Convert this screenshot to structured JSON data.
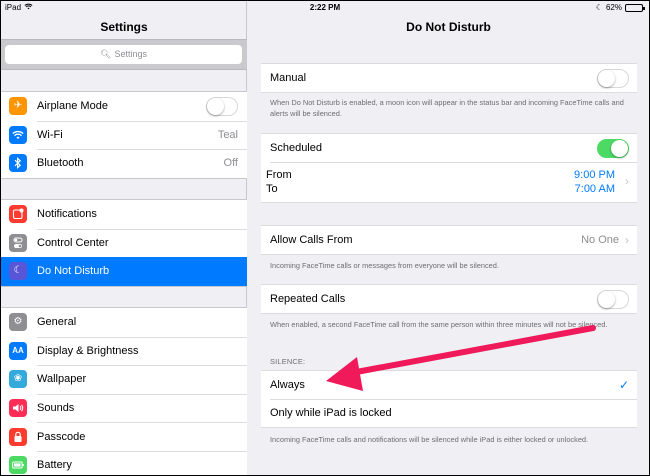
{
  "status": {
    "device": "iPad",
    "time": "2:22 PM",
    "battery": "62%",
    "battery_level": 0.62
  },
  "left": {
    "title": "Settings",
    "search_placeholder": "Settings",
    "groups": [
      [
        {
          "label": "Airplane Mode",
          "icon": "airplane-icon",
          "color": "#ff9500",
          "value": "",
          "toggle": false
        },
        {
          "label": "Wi-Fi",
          "icon": "wifi-icon",
          "color": "#007aff",
          "value": "Teal"
        },
        {
          "label": "Bluetooth",
          "icon": "bluetooth-icon",
          "color": "#007aff",
          "value": "Off"
        }
      ],
      [
        {
          "label": "Notifications",
          "icon": "notifications-icon",
          "color": "#ff3b30"
        },
        {
          "label": "Control Center",
          "icon": "control-center-icon",
          "color": "#8e8e93"
        },
        {
          "label": "Do Not Disturb",
          "icon": "moon-icon",
          "color": "#5856d6",
          "selected": true
        }
      ],
      [
        {
          "label": "General",
          "icon": "gear-icon",
          "color": "#8e8e93"
        },
        {
          "label": "Display & Brightness",
          "icon": "display-icon",
          "color": "#007aff"
        },
        {
          "label": "Wallpaper",
          "icon": "wallpaper-icon",
          "color": "#34aadc"
        },
        {
          "label": "Sounds",
          "icon": "sounds-icon",
          "color": "#ff2d55"
        },
        {
          "label": "Passcode",
          "icon": "lock-icon",
          "color": "#ff3b30"
        },
        {
          "label": "Battery",
          "icon": "battery-icon",
          "color": "#4cd964"
        }
      ]
    ]
  },
  "right": {
    "title": "Do Not Disturb",
    "manual": {
      "label": "Manual",
      "on": false,
      "note": "When Do Not Disturb is enabled, a moon icon will appear in the status bar and incoming FaceTime calls and alerts will be silenced."
    },
    "scheduled": {
      "label": "Scheduled",
      "on": true,
      "from_label": "From",
      "to_label": "To",
      "from": "9:00 PM",
      "to": "7:00 AM"
    },
    "allow_calls": {
      "label": "Allow Calls From",
      "value": "No One",
      "note": "Incoming FaceTime calls or messages from everyone will be silenced."
    },
    "repeated": {
      "label": "Repeated Calls",
      "on": false,
      "note": "When enabled, a second FaceTime call from the same person within three minutes will not be silenced."
    },
    "silence": {
      "header": "SILENCE:",
      "options": [
        {
          "label": "Always",
          "checked": true
        },
        {
          "label": "Only while iPad is locked",
          "checked": false
        }
      ],
      "note": "Incoming FaceTime calls and notifications will be silenced while iPad is either locked or unlocked."
    }
  },
  "accent": "#007aff",
  "annotation_color": "#f0195a"
}
